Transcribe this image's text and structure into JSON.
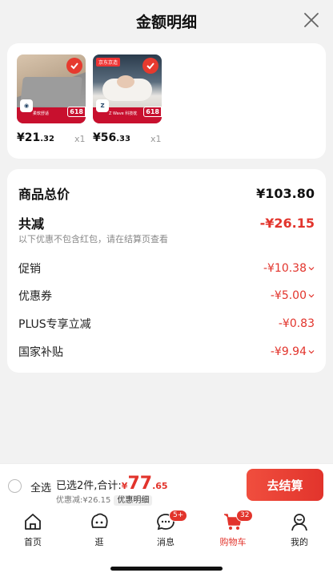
{
  "header": {
    "title": "金额明细"
  },
  "products": [
    {
      "price_int": "¥21",
      "price_dec": ".32",
      "qty": "x1",
      "brand": "京东京造",
      "strip": "柔软舒适"
    },
    {
      "price_int": "¥56",
      "price_dec": ".33",
      "qty": "x1",
      "brand": "京东京造",
      "strip": "Z Wave 科技枕"
    }
  ],
  "badge": "618",
  "detail": {
    "subtotal_label": "商品总价",
    "subtotal_value": "¥103.80",
    "reduce_label": "共减",
    "reduce_value": "-¥26.15",
    "note": "以下优惠不包含红包，请在结算页查看",
    "promo_label": "促销",
    "promo_value": "-¥10.38",
    "coupon_label": "优惠券",
    "coupon_value": "-¥5.00",
    "plus_label": "PLUS专享立减",
    "plus_value": "-¥0.83",
    "subsidy_label": "国家补贴",
    "subsidy_value": "-¥9.94"
  },
  "checkout": {
    "select_all": "全选",
    "summary_prefix": "已选2件,合计:",
    "currency": "¥",
    "total_int": "77",
    "total_dec": ".65",
    "discount_text": "优惠减:¥26.15",
    "detail_link": "优惠明细",
    "pay_button": "去结算"
  },
  "tabs": [
    {
      "label": "首页",
      "icon": "home-icon"
    },
    {
      "label": "逛",
      "icon": "explore-icon"
    },
    {
      "label": "消息",
      "icon": "message-icon",
      "badge": "5+"
    },
    {
      "label": "购物车",
      "icon": "cart-icon",
      "badge": "32",
      "active": true
    },
    {
      "label": "我的",
      "icon": "profile-icon"
    }
  ],
  "colors": {
    "accent": "#e2342c",
    "background": "#f2f2f2"
  }
}
